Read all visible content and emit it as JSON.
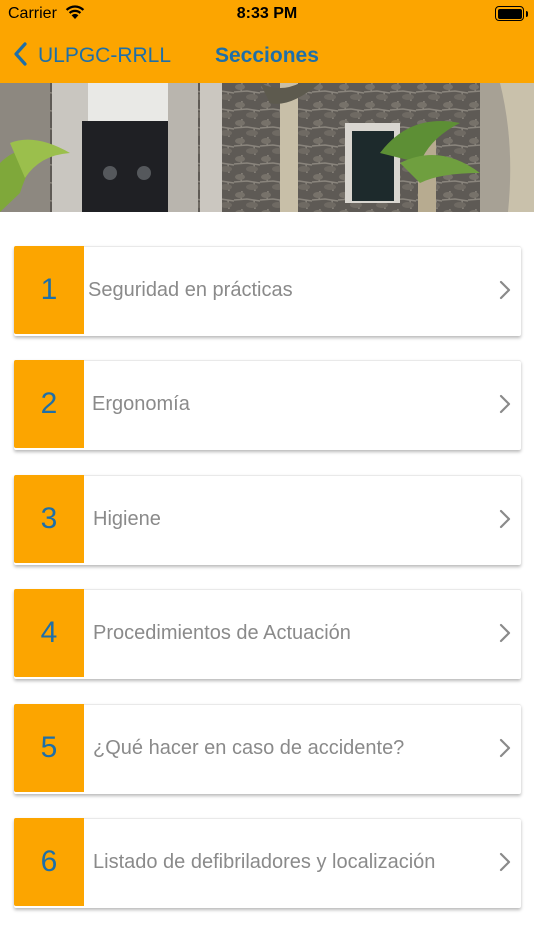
{
  "status_bar": {
    "carrier": "Carrier",
    "time": "8:33 PM"
  },
  "nav": {
    "back_label": "ULPGC-RRLL",
    "title": "Secciones"
  },
  "colors": {
    "accent": "#FCA500",
    "text_blue": "#1E6FA8",
    "label_gray": "#8a8a8a"
  },
  "banner": {
    "icon": "building-photo"
  },
  "sections": [
    {
      "number": "1",
      "label": "Seguridad en prácticas"
    },
    {
      "number": "2",
      "label": "Ergonomía"
    },
    {
      "number": "3",
      "label": "Higiene"
    },
    {
      "number": "4",
      "label": "Procedimientos de Actuación"
    },
    {
      "number": "5",
      "label": "¿Qué hacer en caso de accidente?"
    },
    {
      "number": "6",
      "label": "Listado de defibriladores y localización"
    }
  ]
}
